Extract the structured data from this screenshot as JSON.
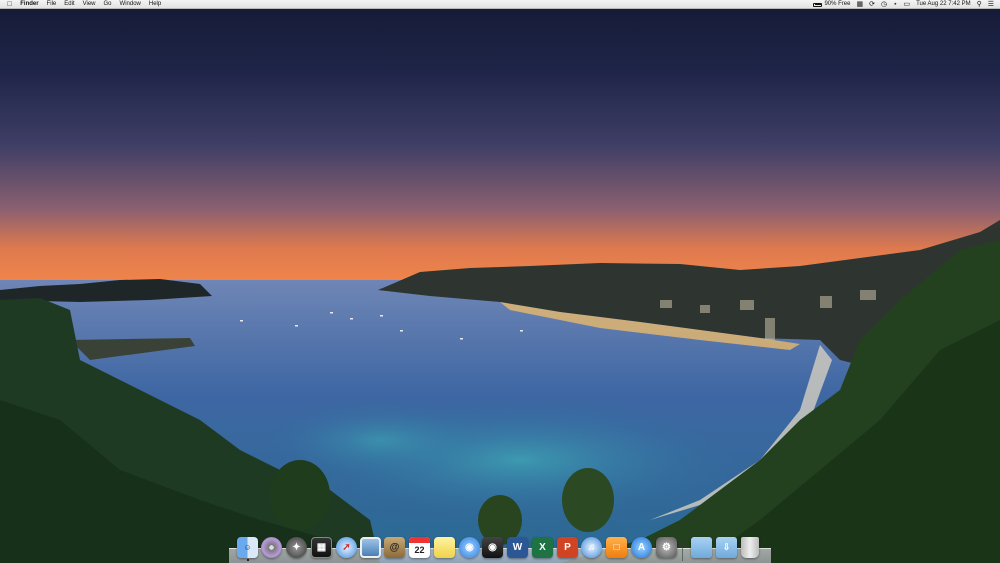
{
  "menubar": {
    "apple_icon": "apple-logo",
    "app_name": "Finder",
    "menus": [
      "File",
      "Edit",
      "View",
      "Go",
      "Window",
      "Help"
    ],
    "battery_text": "90% Free",
    "status_icons": [
      "memory-icon",
      "sync-icon",
      "timemachine-icon",
      "wifi-icon",
      "airplay-icon"
    ],
    "clock": "Tue Aug 22  7:42 PM",
    "search_icon": "spotlight-icon",
    "notif_icon": "notification-center-icon"
  },
  "dock": {
    "apps": [
      {
        "name": "finder",
        "icon": "finder-icon",
        "running": true
      },
      {
        "name": "dvd-player",
        "icon": "dvd-icon",
        "running": false
      },
      {
        "name": "launchpad",
        "icon": "launchpad-icon",
        "running": false
      },
      {
        "name": "mission-control",
        "icon": "mission-control-icon",
        "running": false
      },
      {
        "name": "safari",
        "icon": "safari-icon",
        "running": false
      },
      {
        "name": "preview",
        "icon": "preview-icon",
        "running": false
      },
      {
        "name": "contacts",
        "icon": "contacts-icon",
        "running": false
      },
      {
        "name": "calendar",
        "icon": "calendar-icon",
        "running": false,
        "day": "22"
      },
      {
        "name": "notes",
        "icon": "notes-icon",
        "running": false
      },
      {
        "name": "messages",
        "icon": "messages-icon",
        "running": false
      },
      {
        "name": "photo-booth",
        "icon": "camera-icon",
        "running": false
      },
      {
        "name": "word",
        "icon": "word-icon",
        "running": false,
        "glyph": "W"
      },
      {
        "name": "excel",
        "icon": "excel-icon",
        "running": false,
        "glyph": "X"
      },
      {
        "name": "powerpoint",
        "icon": "powerpoint-icon",
        "running": false,
        "glyph": "P"
      },
      {
        "name": "itunes",
        "icon": "itunes-icon",
        "running": false
      },
      {
        "name": "ibooks",
        "icon": "ibooks-icon",
        "running": false
      },
      {
        "name": "app-store",
        "icon": "app-store-icon",
        "running": false
      },
      {
        "name": "system-preferences",
        "icon": "gear-icon",
        "running": false
      }
    ],
    "stacks": [
      {
        "name": "applications-folder",
        "icon": "folder-icon"
      },
      {
        "name": "downloads-folder",
        "icon": "downloads-folder-icon"
      },
      {
        "name": "trash",
        "icon": "trash-icon"
      }
    ]
  }
}
